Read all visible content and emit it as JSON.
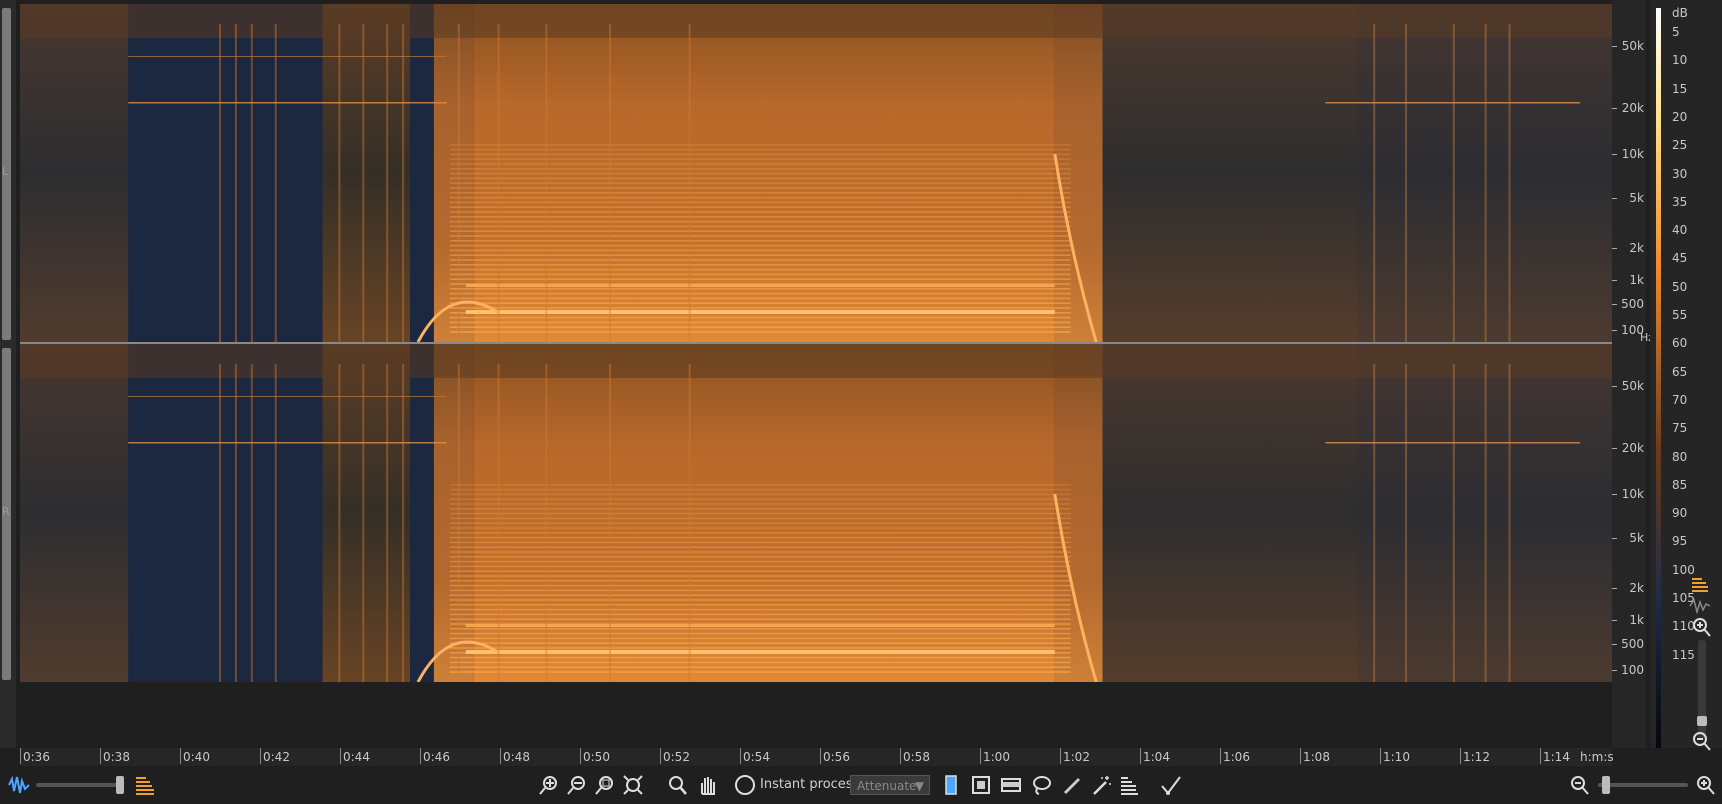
{
  "channels": {
    "left_label": "L",
    "right_label": "R"
  },
  "freq_axis": {
    "unit": "Hz",
    "ticks": [
      "50k",
      "20k",
      "10k",
      "5k",
      "2k",
      "1k",
      "500",
      "100"
    ]
  },
  "db_scale": {
    "unit": "dB",
    "ticks": [
      "5",
      "10",
      "15",
      "20",
      "25",
      "30",
      "35",
      "40",
      "45",
      "50",
      "55",
      "60",
      "65",
      "70",
      "75",
      "80",
      "85",
      "90",
      "95",
      "100",
      "105",
      "110",
      "115"
    ]
  },
  "time_axis": {
    "unit": "h:m:s",
    "ticks": [
      "0:36",
      "0:38",
      "0:40",
      "0:42",
      "0:44",
      "0:46",
      "0:48",
      "0:50",
      "0:52",
      "0:54",
      "0:56",
      "0:58",
      "1:00",
      "1:02",
      "1:04",
      "1:06",
      "1:08",
      "1:10",
      "1:12",
      "1:14"
    ]
  },
  "toolbar": {
    "instant_process_label": "Instant process",
    "attenuate_value": "Attenuate"
  },
  "colors": {
    "spectrogram_hot": "#f08a30",
    "spectrogram_cold": "#1e2c48",
    "background": "#1f1f1f"
  },
  "icons": [
    "waveform-icon",
    "spectrogram-icon",
    "zoom-in-icon",
    "zoom-out-icon",
    "zoom-selection-icon",
    "zoom-fit-icon",
    "magnifier-icon",
    "hand-icon",
    "instant-process-icon",
    "time-selection-icon",
    "rectangle-selection-icon",
    "frequency-selection-icon",
    "lasso-icon",
    "brush-icon",
    "magic-wand-icon",
    "harmonic-selection-icon",
    "fade-icon"
  ]
}
